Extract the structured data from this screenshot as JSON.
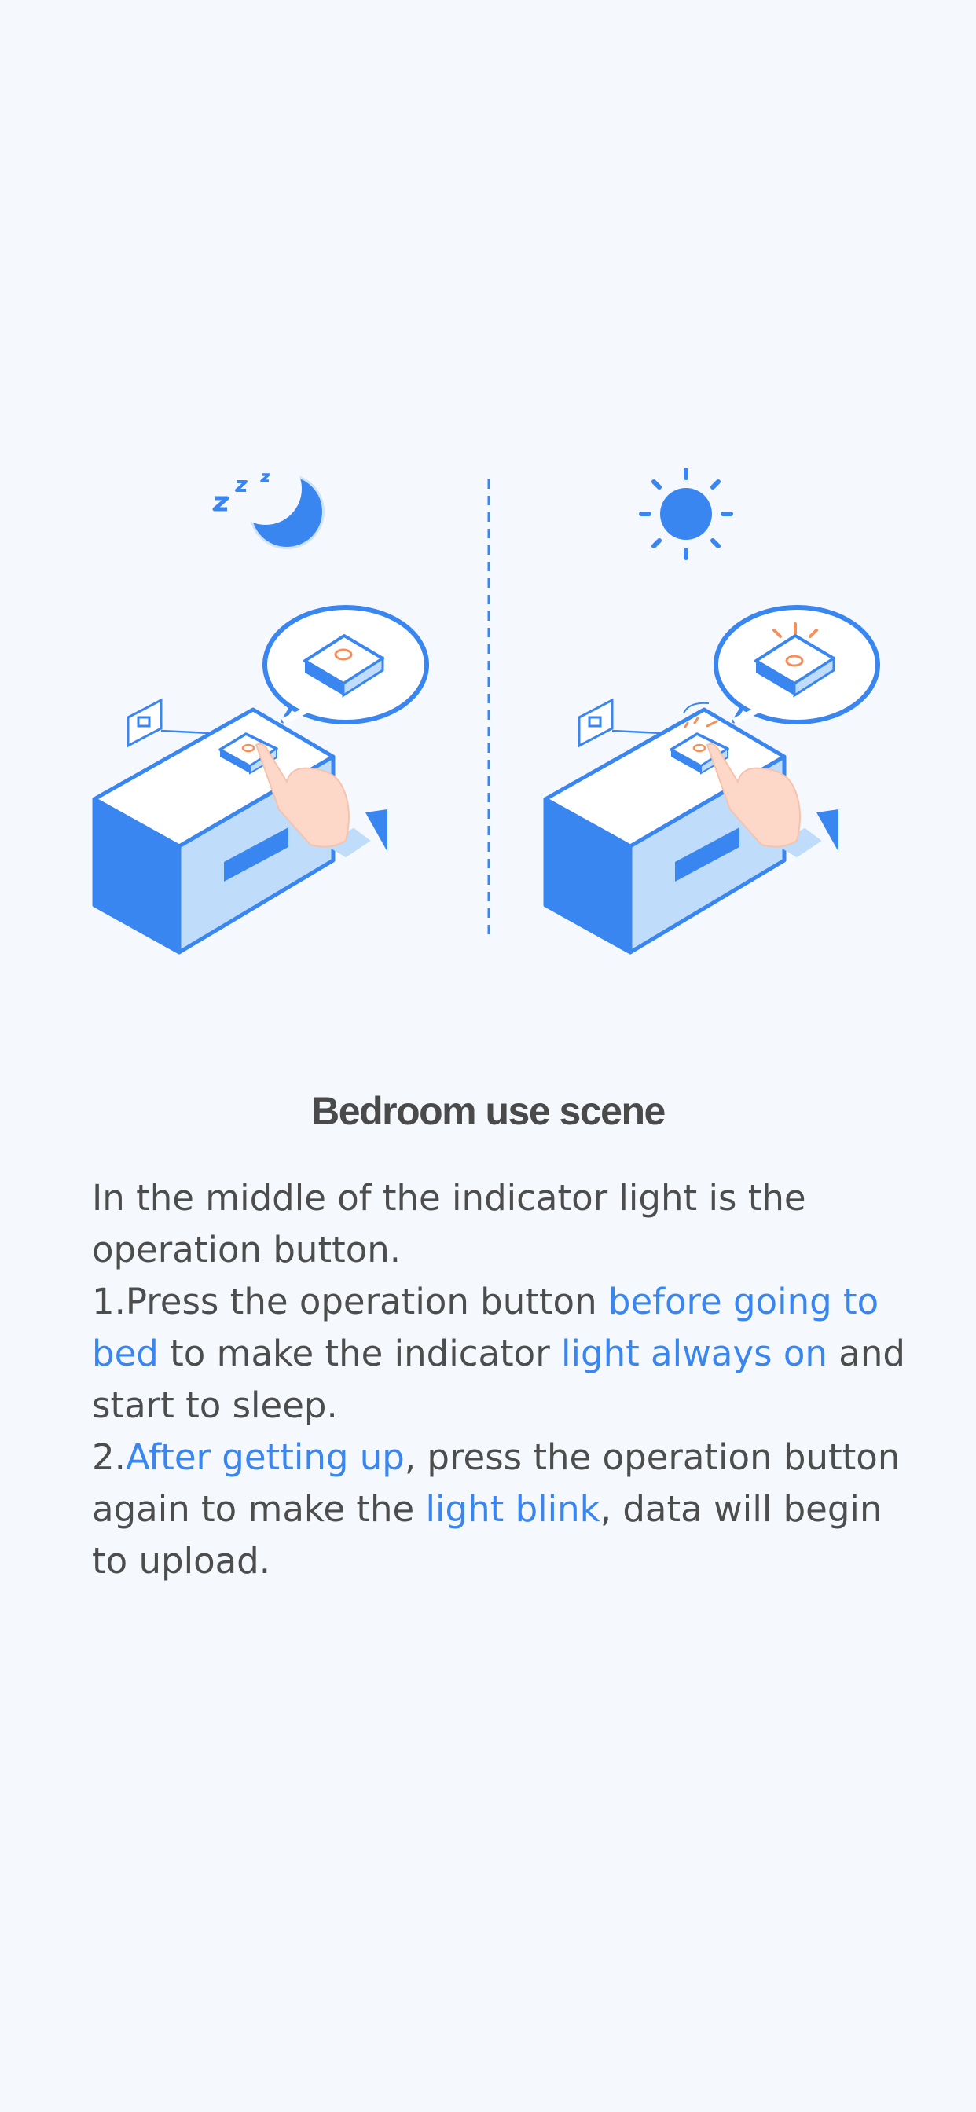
{
  "scene": {
    "title": "Bedroom use scene",
    "intro": "In the middle of the indicator light is the operation button.",
    "step1": {
      "prefix": "1.Press the operation button ",
      "highlight1": "before going to bed",
      "middle": " to make the indicator ",
      "highlight2": "light always on",
      "suffix": " and start to sleep."
    },
    "step2": {
      "prefix": "2.",
      "highlight1": "After getting up",
      "middle": ", press the operation button again to make the ",
      "highlight2": "light blink",
      "suffix": ", data will begin to upload."
    }
  },
  "colors": {
    "background": "#f5f9fd",
    "accent": "#3a86f0",
    "light_accent": "#bfdcfb",
    "text": "#4d4d4d",
    "glow": "#f5905a"
  },
  "icons": {
    "night": "moon-zzz-icon",
    "day": "sun-icon"
  }
}
